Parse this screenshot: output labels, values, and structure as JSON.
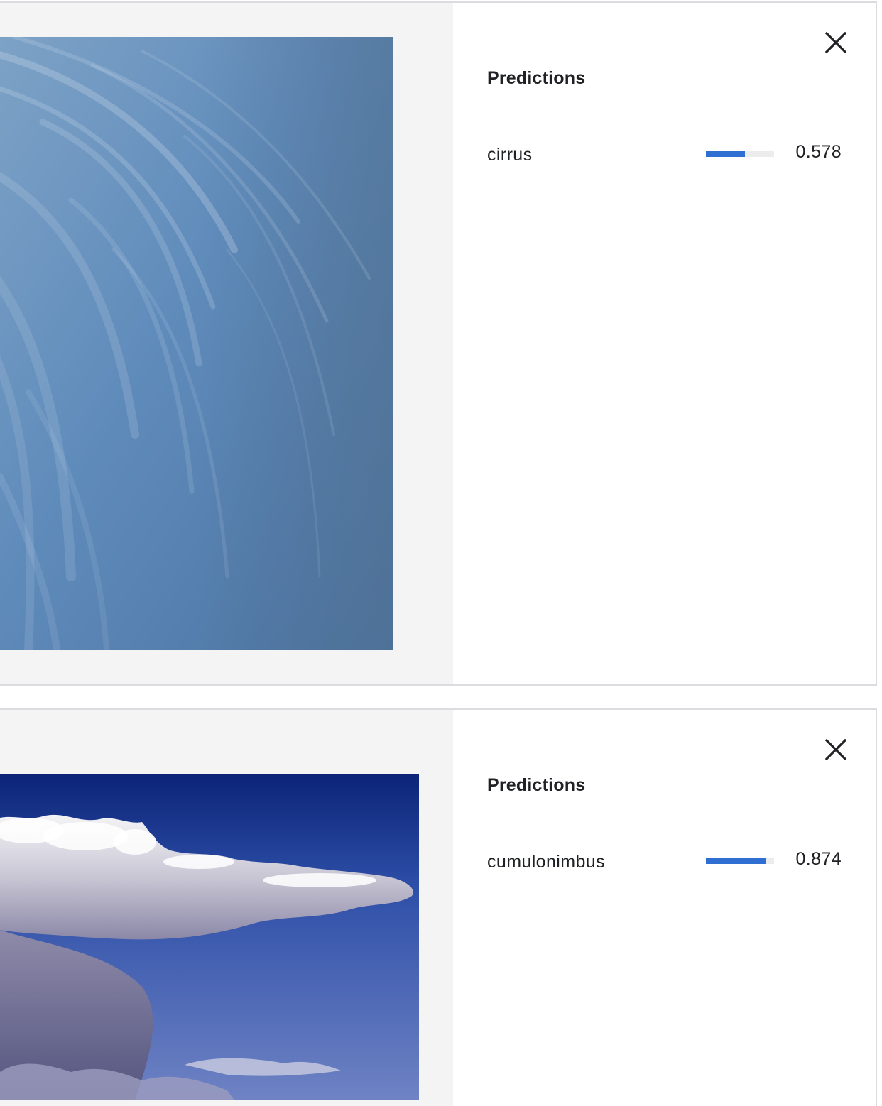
{
  "colors": {
    "accent": "#2f6fd1",
    "bar_track": "#ececec",
    "image_bg": "#f4f4f4",
    "text": "#202124"
  },
  "cards": [
    {
      "image_description": "cirrus",
      "panel_title": "Predictions",
      "close_icon": "close-icon",
      "predictions": [
        {
          "label": "cirrus",
          "score": "0.578",
          "fraction": 0.578
        }
      ]
    },
    {
      "image_description": "cumulonimbus",
      "panel_title": "Predictions",
      "close_icon": "close-icon",
      "predictions": [
        {
          "label": "cumulonimbus",
          "score": "0.874",
          "fraction": 0.874
        }
      ]
    }
  ]
}
